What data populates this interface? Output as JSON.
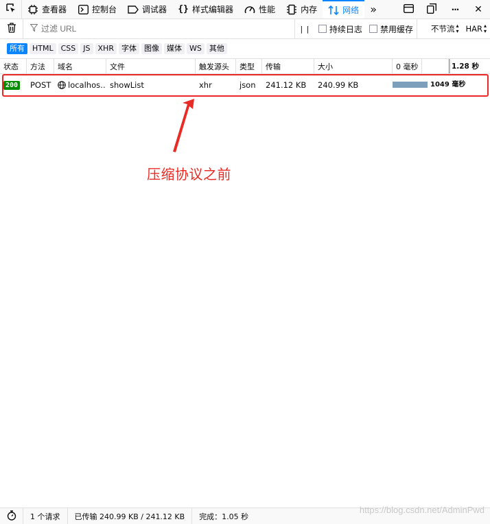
{
  "toolbar": {
    "tabs": [
      {
        "label": "查看器",
        "icon": "inspector-icon"
      },
      {
        "label": "控制台",
        "icon": "console-icon"
      },
      {
        "label": "调试器",
        "icon": "debugger-icon"
      },
      {
        "label": "样式编辑器",
        "icon": "style-editor-icon"
      },
      {
        "label": "性能",
        "icon": "performance-icon"
      },
      {
        "label": "内存",
        "icon": "memory-icon"
      },
      {
        "label": "网络",
        "icon": "network-icon",
        "active": true
      }
    ],
    "overflow_glyph": "»",
    "close_glyph": "✕",
    "meatball_glyph": "···"
  },
  "filter": {
    "placeholder": "过滤 URL",
    "pause_glyph": "| |",
    "persist_logs": "持续日志",
    "persist_logs_checked": false,
    "disable_cache": "禁用缓存",
    "disable_cache_checked": false,
    "throttling": "不节流",
    "har": "HAR"
  },
  "type_filters": [
    {
      "label": "所有",
      "checked": true
    },
    {
      "label": "HTML"
    },
    {
      "label": "CSS"
    },
    {
      "label": "JS"
    },
    {
      "label": "XHR"
    },
    {
      "label": "字体"
    },
    {
      "label": "图像"
    },
    {
      "label": "媒体"
    },
    {
      "label": "WS"
    },
    {
      "label": "其他"
    }
  ],
  "columns": {
    "status": "状态",
    "method": "方法",
    "domain": "域名",
    "file": "文件",
    "cause": "触发源头",
    "type": "类型",
    "transferred": "传输",
    "size": "大小",
    "waterfall_start": "0 毫秒",
    "waterfall_end": "1.28 秒"
  },
  "requests": [
    {
      "status": "200",
      "method": "POST",
      "domain": "localhos…",
      "file": "showList",
      "cause": "xhr",
      "type": "json",
      "transferred": "241.12 KB",
      "size": "240.99 KB",
      "duration_label": "1049 毫秒",
      "duration_ms": 1049
    }
  ],
  "annotation": {
    "text": "压缩协议之前",
    "color": "#e82b25"
  },
  "footer": {
    "requests": "1 个请求",
    "transferred": "已传输 240.99 KB / 241.12 KB",
    "finish": "完成：1.05 秒"
  },
  "watermark": "https://blog.csdn.net/AdminPwd",
  "colors": {
    "accent": "#0a84ff",
    "status_ok": "#058b00",
    "highlight": "#ea2626",
    "waterfall_bar": "#7d9fbc"
  }
}
